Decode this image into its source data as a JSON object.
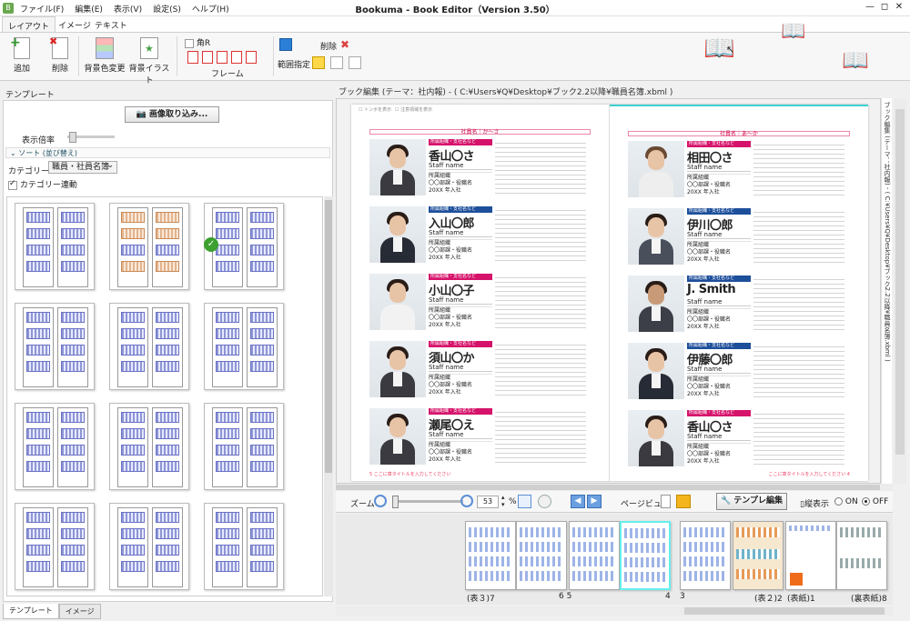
{
  "app": {
    "title": "Bookuma - Book Editor（Version 3.50）",
    "menu": [
      "ファイル(F)",
      "編集(E)",
      "表示(V)",
      "設定(S)",
      "ヘルプ(H)"
    ],
    "window_controls": [
      "—",
      "◻",
      "✕"
    ]
  },
  "ribbon": {
    "tabs": [
      "レイアウト",
      "イメージ",
      "テキスト"
    ],
    "buttons": {
      "add": "追加",
      "delete": "削除",
      "bg_color": "背景色変更",
      "bg_illust": "背景イラスト"
    },
    "corner_r": "角R",
    "frame_label": "フレーム",
    "range_label": "範囲指定",
    "range_delete": "削除"
  },
  "left_panel": {
    "header": "テンプレート",
    "import_button": "画像取り込み...",
    "zoom_label": "表示倍率",
    "sort_label": "ソート (並び替え)",
    "category_label": "カテゴリー",
    "category_value": "職員・社員名簿",
    "category_link": "カテゴリー連動",
    "bottom_tabs": [
      "テンプレート",
      "イメージ"
    ]
  },
  "editor": {
    "header": "ブック編集 (テーマ：社内報) - ( C:¥Users¥Q¥Desktop¥ブック2.2以降¥職員名簿.xbml )",
    "side_label": "ブック編集 (テーマ：社内報) - ( C:¥Users¥Q¥Desktop¥ブック2.2以降¥職員名簿.xbml )",
    "top_checks": [
      "トンボを表示",
      "注意領域を表示"
    ],
    "left_category": "社員名｜か～さ",
    "right_category": "社員名｜あ～か",
    "left_footer": "5  ここに章タイトルを入力してください",
    "right_footer": "ここに章タイトルを入力してください  4",
    "staff_tag": "所属組織・支社名など",
    "staff_sub": "Staff name",
    "staff_org": "所属組織",
    "staff_dept": "〇〇部課・役職名",
    "staff_year": "20XX 年入社",
    "left_names": [
      "香山〇さ",
      "入山〇郎",
      "小山〇子",
      "須山〇か",
      "瀬尾〇え"
    ],
    "right_names": [
      "相田〇さ",
      "伊川〇郎",
      "J. Smith",
      "伊藤〇郎",
      "香山〇さ"
    ]
  },
  "toolbar": {
    "zoom_label": "ズーム",
    "zoom_value": "53",
    "zoom_unit": "%",
    "page_view": "ページビュー",
    "template_edit": "テンプレ編集",
    "vertical_display": "縦表示",
    "on_label": "ON",
    "off_label": "OFF"
  },
  "pages_strip": {
    "labels": [
      "(表３)7",
      "6 5",
      "4",
      "3",
      "(表２)2",
      "(表紙)1",
      "(裏表紙)8"
    ]
  }
}
